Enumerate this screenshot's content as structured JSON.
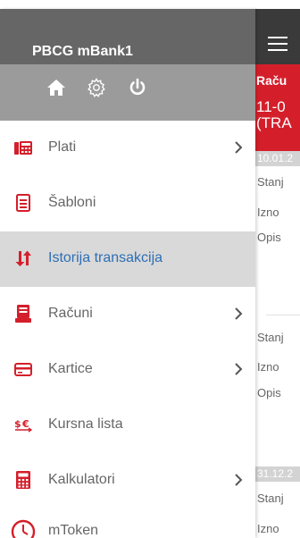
{
  "app": {
    "title": "PBCG mBank1"
  },
  "icons": {
    "home": "home-icon",
    "settings": "gear-icon",
    "power": "power-icon",
    "menu": "hamburger-menu-icon"
  },
  "colors": {
    "header_dark": "#666666",
    "iconbar": "#9b9b9b",
    "accent_red": "#d41f2b",
    "active_text": "#2d6fb6",
    "active_bg": "#d9d9d9"
  },
  "nav": {
    "items": [
      {
        "label": "Plati",
        "icon": "payment-terminal-icon",
        "has_submenu": true,
        "active": false
      },
      {
        "label": "Šabloni",
        "icon": "document-icon",
        "has_submenu": false,
        "active": false
      },
      {
        "label": "Istorija transakcija",
        "icon": "transfer-arrows-icon",
        "has_submenu": false,
        "active": true
      },
      {
        "label": "Računi",
        "icon": "accounts-icon",
        "has_submenu": true,
        "active": false
      },
      {
        "label": "Kartice",
        "icon": "card-icon",
        "has_submenu": true,
        "active": false
      },
      {
        "label": "Kursna lista",
        "icon": "exchange-rate-icon",
        "has_submenu": false,
        "active": false
      },
      {
        "label": "Kalkulatori",
        "icon": "calculator-icon",
        "has_submenu": true,
        "active": false
      },
      {
        "label": "mToken",
        "icon": "clock-icon",
        "has_submenu": false,
        "active": false
      }
    ]
  },
  "background": {
    "account": {
      "title": "Raču",
      "number": "11-0",
      "type": "(TRA"
    },
    "groups": [
      {
        "date": "10.01.2",
        "entries": [
          {
            "fields": [
              "Stanj",
              "Izno",
              "Opis"
            ]
          },
          {
            "fields": [
              "Stanj",
              "Izno",
              "Opis"
            ]
          }
        ]
      },
      {
        "date": "31.12.2",
        "entries": [
          {
            "fields": [
              "Stanj",
              "Izno"
            ]
          }
        ]
      }
    ]
  }
}
